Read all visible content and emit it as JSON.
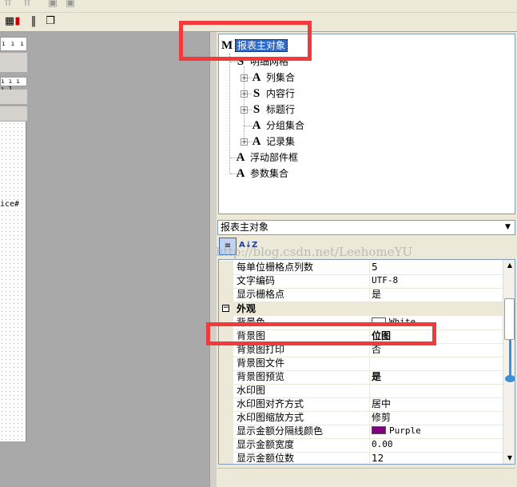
{
  "toolbar": {
    "top_icons": [
      "align-icon",
      "align-plus-icon",
      "overlap-icon"
    ],
    "main_icons": [
      "table-icon",
      "books-icon",
      "barcode-icon",
      "copy-icon"
    ]
  },
  "designer": {
    "ruler_text": "ı ı ı ı 2",
    "ruler2_text": "ı ı ı ı 1",
    "canvas_label": "ice#"
  },
  "tree": {
    "root": {
      "glyph": "M",
      "label": "报表主对象"
    },
    "group": {
      "glyph": "S",
      "label": "明细网格"
    },
    "children": [
      {
        "glyph": "A",
        "label": "列集合",
        "expandable": true
      },
      {
        "glyph": "S",
        "label": "内容行",
        "expandable": true
      },
      {
        "glyph": "S",
        "label": "标题行",
        "expandable": true
      },
      {
        "glyph": "A",
        "label": "分组集合",
        "expandable": false
      },
      {
        "glyph": "A",
        "label": "记录集",
        "expandable": true
      }
    ],
    "siblings": [
      {
        "glyph": "A",
        "label": "浮动部件框"
      },
      {
        "glyph": "A",
        "label": "参数集合"
      }
    ]
  },
  "object_selector": {
    "value": "报表主对象"
  },
  "prop_toolbar": {
    "categorized_label": "≡",
    "alpha_label": "A↓Z"
  },
  "watermark": "http://blog.csdn.net/LeehomeYU",
  "properties": {
    "top_rows": [
      {
        "name": "每单位栅格点列数",
        "value": "5",
        "style": "normal"
      },
      {
        "name": "文字编码",
        "value": "UTF-8",
        "style": "mono"
      },
      {
        "name": "显示栅格点",
        "value": "是",
        "style": "normal"
      }
    ],
    "category": {
      "toggle": "−",
      "name": "外观"
    },
    "appearance_rows": [
      {
        "name": "背景色",
        "value": "White",
        "style": "mono",
        "swatch": "#ffffff"
      },
      {
        "name": "背景图",
        "value": "位图",
        "style": "bold"
      },
      {
        "name": "背景图打印",
        "value": "否",
        "style": "normal"
      },
      {
        "name": "背景图文件",
        "value": "",
        "style": "normal"
      },
      {
        "name": "背景图预览",
        "value": "是",
        "style": "bold"
      },
      {
        "name": "水印图",
        "value": "",
        "style": "normal"
      },
      {
        "name": "水印图对齐方式",
        "value": "居中",
        "style": "normal"
      },
      {
        "name": "水印图缩放方式",
        "value": "修剪",
        "style": "normal"
      },
      {
        "name": "显示金额分隔线颜色",
        "value": "Purple",
        "style": "mono",
        "swatch": "#800080"
      },
      {
        "name": "显示金额宽度",
        "value": "0.00",
        "style": "mono"
      },
      {
        "name": "显示金额位数",
        "value": "12",
        "style": "normal"
      }
    ]
  },
  "colors": {
    "highlight": "#f2393c",
    "selection": "#316ac5",
    "panel": "#ece9d8"
  }
}
